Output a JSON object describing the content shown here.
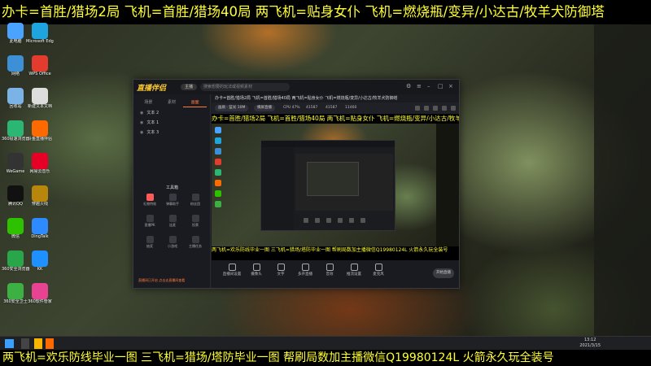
{
  "banner": {
    "top": "办卡=首胜/猎场2局 飞机=首胜/猎场40局 两飞机=贴身女仆 飞机=燃烧瓶/变异/小达古/牧羊犬防御塔",
    "bottom": "两飞机=欢乐防线毕业一图 三飞机=猎场/塔防毕业一图 帮刷局数加主播微信Q19980124L 火箭永久玩全装号"
  },
  "desktop": {
    "icons": [
      {
        "label": "此电脑",
        "icon": "computer-icon",
        "color": "#4aa3ff"
      },
      {
        "label": "Microsoft Edge",
        "icon": "edge-icon",
        "color": "#1ea5e0"
      },
      {
        "label": "网络",
        "icon": "network-icon",
        "color": "#3d8fd6"
      },
      {
        "label": "WPS Office",
        "icon": "wps-icon",
        "color": "#e33b2e"
      },
      {
        "label": "回收站",
        "icon": "recycle-bin-icon",
        "color": "#7bb3e6"
      },
      {
        "label": "新建文本文档",
        "icon": "document-icon",
        "color": "#dddddd"
      },
      {
        "label": "360极速浏览器",
        "icon": "browser-icon",
        "color": "#2bb673"
      },
      {
        "label": "斗鱼直播伴侣",
        "icon": "douyu-icon",
        "color": "#ff6a00"
      },
      {
        "label": "WeGame",
        "icon": "wegame-icon",
        "color": "#333333"
      },
      {
        "label": "网易云音乐",
        "icon": "music-icon",
        "color": "#e60026"
      },
      {
        "label": "腾讯QQ",
        "icon": "qq-icon",
        "color": "#111111"
      },
      {
        "label": "穿越火线",
        "icon": "game-icon",
        "color": "#b8860b"
      },
      {
        "label": "微信",
        "icon": "wechat-icon",
        "color": "#2dc100"
      },
      {
        "label": "DingTalk",
        "icon": "dingtalk-icon",
        "color": "#2e8bff"
      },
      {
        "label": "360安全浏览器",
        "icon": "safe-browser-icon",
        "color": "#29a64a"
      },
      {
        "label": "KK",
        "icon": "kk-icon",
        "color": "#1e90ff"
      },
      {
        "label": "360安全卫士",
        "icon": "shield-icon",
        "color": "#3cb043"
      },
      {
        "label": "360软件管家",
        "icon": "software-icon",
        "color": "#e84393"
      }
    ]
  },
  "app": {
    "name": "直播伴侣",
    "badge": "主播",
    "search_placeholder": "搜索想要的玩法或视频素材",
    "side_tabs": [
      "场景",
      "素材",
      "画面"
    ],
    "scenes": [
      "文本 2",
      "文本 1",
      "文本 3"
    ],
    "tools_title": "工具箱",
    "tools": [
      {
        "label": "礼物特效",
        "hot": true
      },
      {
        "label": "弹幕助手",
        "hot": false
      },
      {
        "label": "粉丝团",
        "hot": false
      },
      {
        "label": "直播PK",
        "hot": false
      },
      {
        "label": "连麦",
        "hot": false
      },
      {
        "label": "投票",
        "hot": false
      },
      {
        "label": "抽奖",
        "hot": false
      },
      {
        "label": "小游戏",
        "hot": false
      },
      {
        "label": "主播任务",
        "hot": false
      }
    ],
    "side_footer": "直播间已开启 点击去直播间查看",
    "main_title": "办卡=首胜/猎场2局 飞机=首胜/猎场40局 两飞机=贴身女仆 飞机=燃烧瓶/变异/小达古/牧羊犬防御塔",
    "bar": {
      "chip1": "画质 · 蓝光 10M",
      "chip2": "横屏直播",
      "stat1": "CPU 47%",
      "stat2": "41587",
      "stat3": "41587",
      "stat4": "11460"
    },
    "preview": {
      "top_text": "办卡=首胜/猎场2局 飞机=首胜/猎场40局 两飞机=贴身女仆 飞机=燃烧瓶/变异/小达古/牧羊犬防御塔",
      "bottom_text": "两飞机=欢乐防线毕业一图 三飞机=猎场/塔防毕业一图 帮刷局数加主播微信Q19980124L 火箭永久玩全装号"
    },
    "controls": [
      "直播间设置",
      "摄像头",
      "文字",
      "多开直播",
      "音效",
      "推流设置",
      "麦克风"
    ],
    "live_button": "开始直播"
  },
  "taskbar": {
    "time": "13:12",
    "date": "2021/3/15"
  },
  "colors": {
    "banner_text": "#ffff33",
    "accent": "#ff7a3d"
  }
}
